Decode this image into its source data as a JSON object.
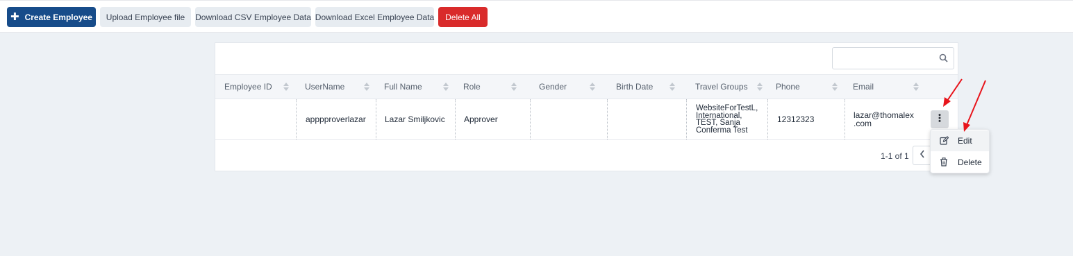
{
  "toolbar": {
    "create_label": "Create Employee",
    "upload_label": "Upload Employee file",
    "download_csv_label": "Download CSV Employee Data",
    "download_excel_label": "Download Excel Employee Data",
    "delete_all_label": "Delete All"
  },
  "search": {
    "placeholder": "",
    "value": ""
  },
  "table": {
    "columns": [
      "Employee ID",
      "UserName",
      "Full Name",
      "Role",
      "Gender",
      "Birth Date",
      "Travel Groups",
      "Phone",
      "Email"
    ],
    "rows": [
      {
        "employee_id": "",
        "username": "apppproverlazar",
        "full_name": "Lazar Smiljkovic",
        "role": "Approver",
        "gender": "",
        "birth_date": "",
        "travel_groups": [
          "WebsiteForTestL,",
          "International,",
          "TEST, Sanja",
          "Conferma Test"
        ],
        "phone": "12312323",
        "email": [
          "lazar@thomalex",
          ".com"
        ]
      }
    ]
  },
  "pagination": {
    "range_text": "1-1 of 1"
  },
  "row_menu": {
    "edit_label": "Edit",
    "delete_label": "Delete"
  },
  "icons": {
    "create": "plus-icon",
    "search": "search-icon",
    "sort": "sort-icon",
    "more": "more-vertical-icon",
    "edit": "edit-icon",
    "delete": "trash-icon",
    "prev": "chevron-left-icon"
  },
  "colors": {
    "primary": "#174c8a",
    "danger": "#d92b2b",
    "annotation_arrow": "#e8141b"
  }
}
